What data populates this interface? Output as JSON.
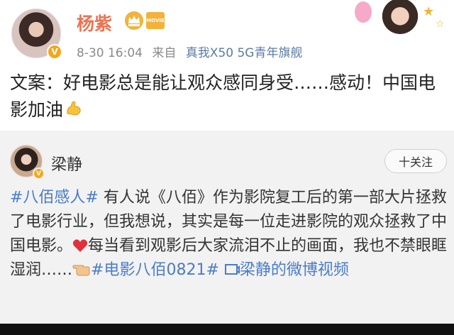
{
  "post": {
    "username": "杨紫",
    "movie_badge": "MOVIE",
    "date": "8-30 16:04",
    "source_prefix": "来自",
    "source_device": "真我X50 5G青年旗舰",
    "text": "文案：好电影总是能让观众感同身受……感动！中国电影加油",
    "verified_badge": "V"
  },
  "retweet": {
    "username": "梁静",
    "verified_badge": "V",
    "follow_label": "十关注",
    "hashtag_1": "#八佰感人#",
    "text_1": " 有人说《八佰》作为影院复工后的第一部大片拯救了电影行业，但我想说，其实是每一位走进影院的观众拯救了中国电影。",
    "text_2": "每当看到观影后大家流泪不止的画面，我也不禁眼眶湿润……",
    "hashtag_2": "#电影八佰0821#",
    "video_link": "梁静的微博视频"
  },
  "colors": {
    "username": "#eb7350",
    "link": "#4a7cc9",
    "badge": "#f7a51b",
    "retweet_bg": "#f2f2f2"
  }
}
